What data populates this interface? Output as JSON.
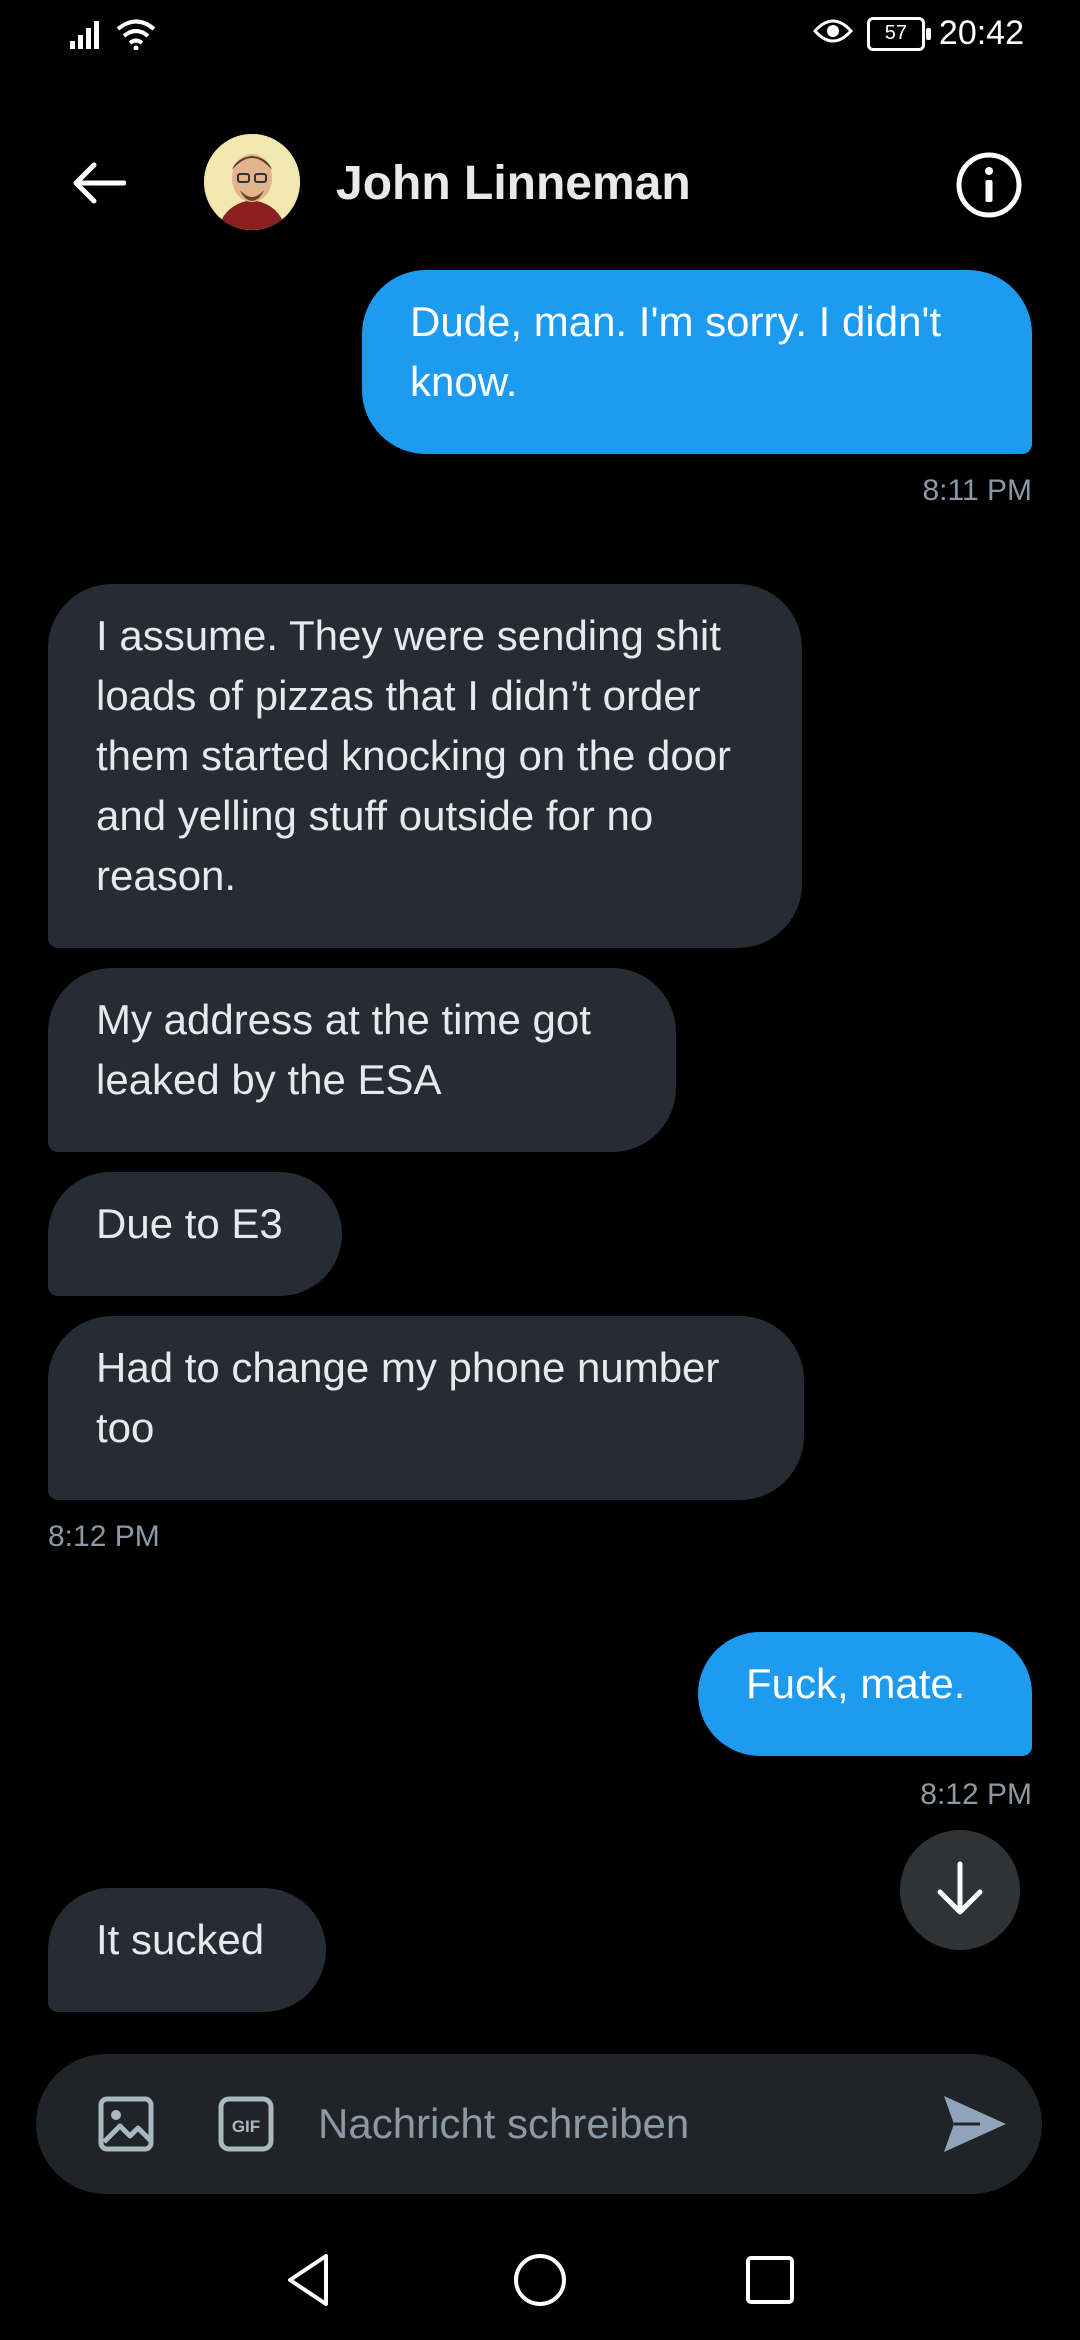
{
  "status_bar": {
    "time": "20:42",
    "battery": "57"
  },
  "header": {
    "contact_name": "John Linneman"
  },
  "messages": [
    {
      "direction": "out",
      "text": "Dude, man. I'm sorry. I didn't know."
    },
    {
      "direction": "in",
      "text": "I assume. They were sending shit loads of pizzas that I didn’t order them started knocking on the door and yelling stuff outside for no reason."
    },
    {
      "direction": "in",
      "text": "My address at the time got leaked by the ESA"
    },
    {
      "direction": "in",
      "text": "Due to E3"
    },
    {
      "direction": "in",
      "text": "Had to change my phone number too"
    },
    {
      "direction": "out",
      "text": "Fuck, mate."
    },
    {
      "direction": "in",
      "text": "It sucked"
    }
  ],
  "timestamps": [
    "8:11 PM",
    "8:12 PM",
    "8:12 PM"
  ],
  "composer": {
    "placeholder": "Nachricht schreiben",
    "gif_label": "GIF"
  },
  "colors": {
    "accent": "#1d9bf0",
    "incoming_bubble": "#252c33",
    "background": "#000000",
    "muted_text": "#8b98a5"
  },
  "icons": [
    "signal-icon",
    "wifi-icon",
    "eye-icon",
    "battery-icon",
    "back-arrow-icon",
    "info-icon",
    "arrow-down-icon",
    "image-icon",
    "gif-icon",
    "send-icon",
    "nav-back-icon",
    "nav-home-icon",
    "nav-recents-icon"
  ]
}
